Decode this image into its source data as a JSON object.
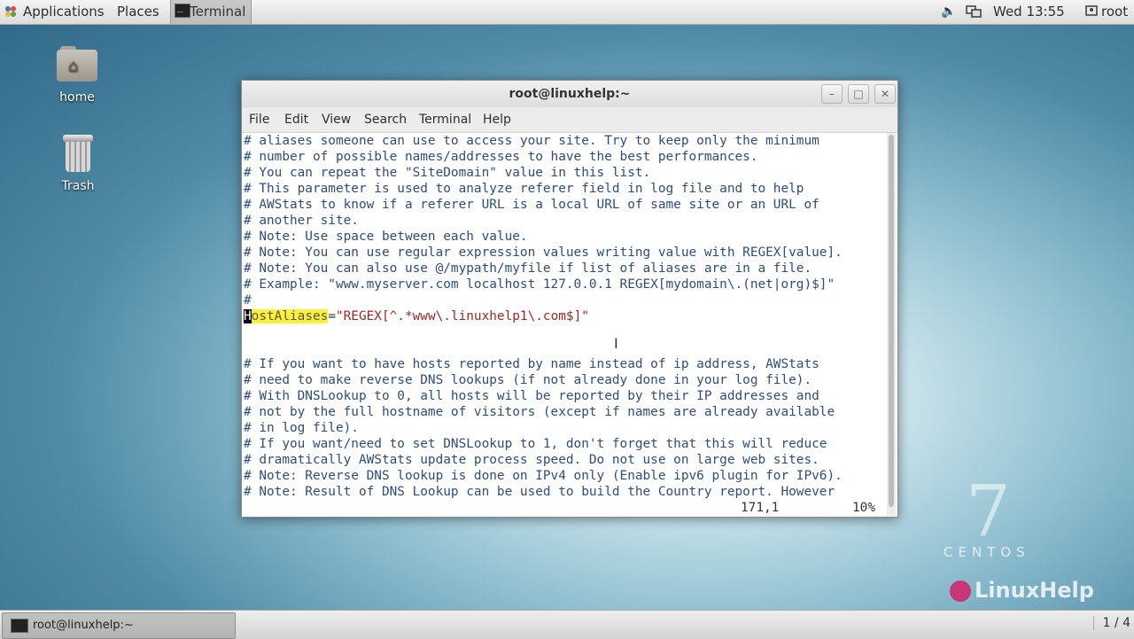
{
  "top_panel": {
    "applications": "Applications",
    "places": "Places",
    "active_app": "Terminal",
    "clock": "Wed 13:55",
    "user": "root",
    "icons": [
      "volume-icon",
      "network-icon",
      "user-icon",
      "terminal-icon",
      "applications-icon"
    ]
  },
  "desktop": {
    "home_label": "home",
    "trash_label": "Trash"
  },
  "window": {
    "title": "root@linuxhelp:~",
    "minimize": "–",
    "maximize": "□",
    "close": "✕",
    "menu": [
      "File",
      "Edit",
      "View",
      "Search",
      "Terminal",
      "Help"
    ]
  },
  "terminal": {
    "lines": [
      "# aliases someone can use to access your site. Try to keep only the minimum",
      "# number of possible names/addresses to have the best performances.",
      "# You can repeat the \"SiteDomain\" value in this list.",
      "# This parameter is used to analyze referer field in log file and to help",
      "# AWStats to know if a referer URL is a local URL of same site or an URL of",
      "# another site.",
      "# Note: Use space between each value.",
      "# Note: You can use regular expression values writing value with REGEX[value].",
      "# Note: You can also use @/mypath/myfile if list of aliases are in a file.",
      "# Example: \"www.myserver.com localhost 127.0.0.1 REGEX[mydomain\\.(net|org)$]\"",
      "#"
    ],
    "directive_cursor": "H",
    "directive_rest": "ostAliases",
    "directive_equals": "=",
    "directive_value": "\"REGEX[^.*www\\.linuxhelp1\\.com$]\"",
    "lines_after": [
      "",
      "",
      "# If you want to have hosts reported by name instead of ip address, AWStats",
      "# need to make reverse DNS lookups (if not already done in your log file).",
      "# With DNSLookup to 0, all hosts will be reported by their IP addresses and",
      "# not by the full hostname of visitors (except if names are already available",
      "# in log file).",
      "# If you want/need to set DNSLookup to 1, don't forget that this will reduce",
      "# dramatically AWStats update process speed. Do not use on large web sites.",
      "# Note: Reverse DNS lookup is done on IPv4 only (Enable ipv6 plugin for IPv6).",
      "# Note: Result of DNS Lookup can be used to build the Country report. However"
    ],
    "status_position": "171,1",
    "status_percent": "10%"
  },
  "branding": {
    "centos_number": "7",
    "centos_text": "CENTOS",
    "watermark": "LinuxHelp"
  },
  "bottom_panel": {
    "task_label": "root@linuxhelp:~",
    "workspace": "1 / 4"
  },
  "colors": {
    "comment": "#2e4c7c",
    "string": "#a02626",
    "search_highlight": "#fff13a"
  }
}
